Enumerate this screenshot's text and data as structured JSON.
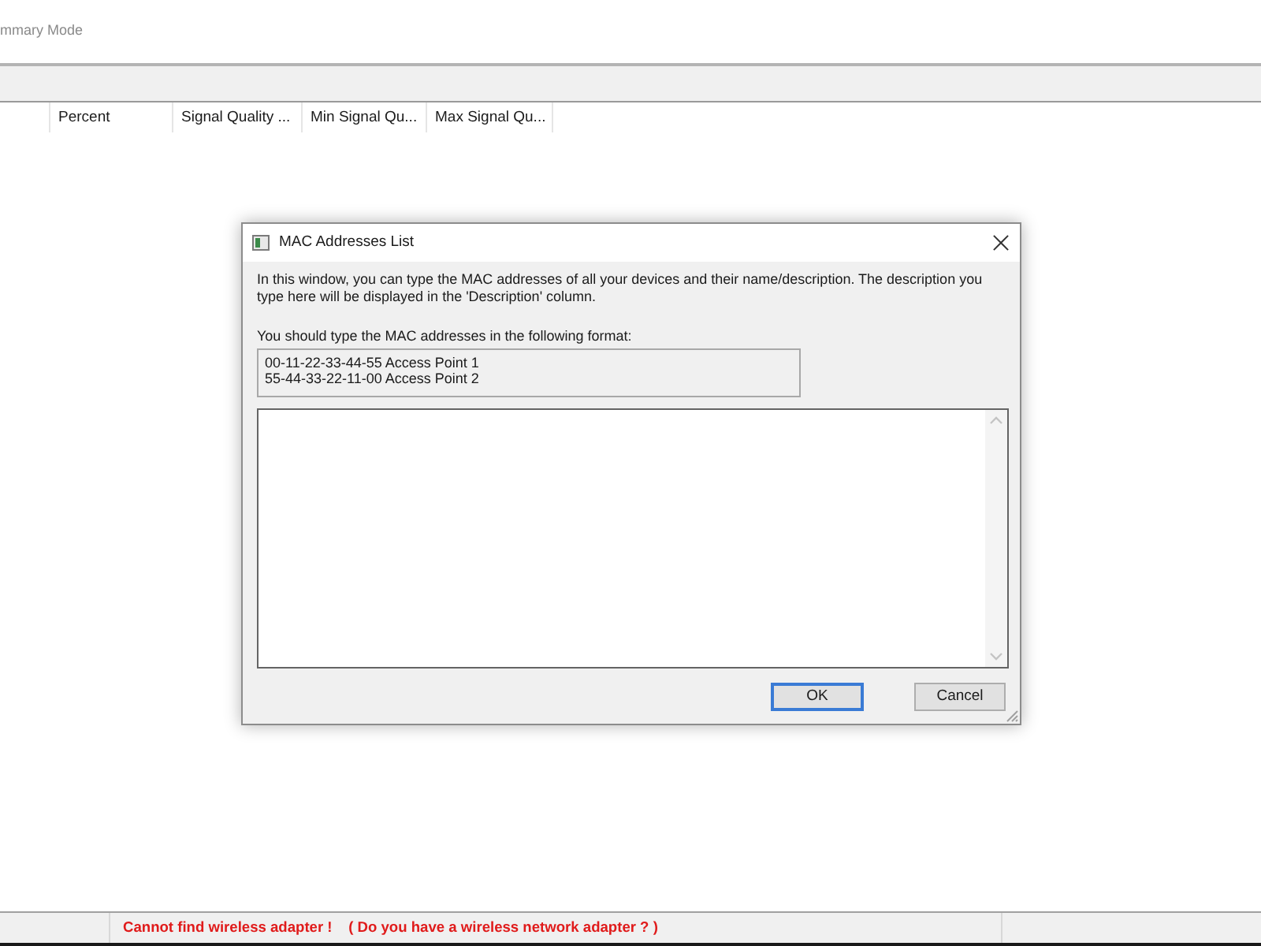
{
  "main_window": {
    "mode_label": "mmary Mode"
  },
  "list": {
    "columns": [
      "Percent",
      "Signal Quality ...",
      "Min Signal Qu...",
      "Max Signal Qu..."
    ]
  },
  "dialog": {
    "title": "MAC Addresses List",
    "description": "In this window, you can type the MAC addresses of all your devices and their name/description. The description you type here will be displayed in the 'Description' column.",
    "format_label": "You should type the MAC addresses in the following format:",
    "format_example": [
      "00-11-22-33-44-55 Access Point 1",
      "55-44-33-22-11-00 Access Point 2"
    ],
    "buttons": [
      {
        "label": "OK",
        "default": true
      },
      {
        "label": "Cancel",
        "default": false
      }
    ]
  },
  "status_bar": {
    "message": "Cannot find wireless adapter !    ( Do you have a wireless network adapter ? )"
  }
}
